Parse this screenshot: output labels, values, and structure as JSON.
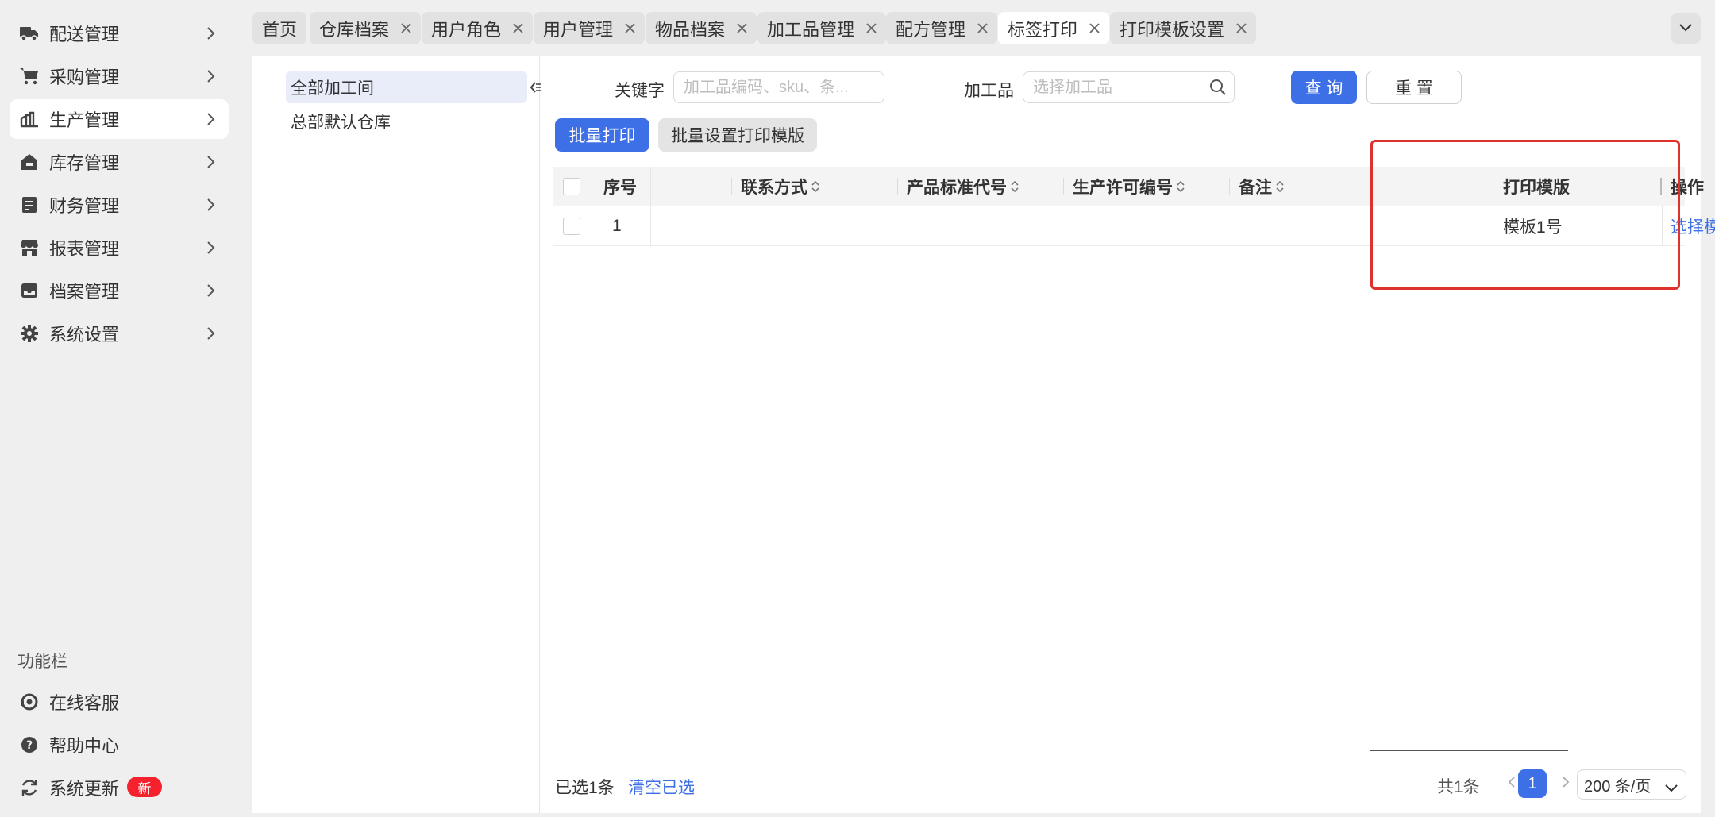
{
  "sidebar": {
    "items": [
      {
        "label": "配送管理",
        "icon": "truck-icon"
      },
      {
        "label": "采购管理",
        "icon": "cart-icon"
      },
      {
        "label": "生产管理",
        "icon": "production-icon"
      },
      {
        "label": "库存管理",
        "icon": "warehouse-icon"
      },
      {
        "label": "财务管理",
        "icon": "finance-icon"
      },
      {
        "label": "报表管理",
        "icon": "store-icon"
      },
      {
        "label": "档案管理",
        "icon": "inbox-icon"
      },
      {
        "label": "系统设置",
        "icon": "gear-icon"
      }
    ],
    "active_index": 2,
    "func_title": "功能栏",
    "func_items": [
      {
        "label": "在线客服",
        "icon": "support-icon"
      },
      {
        "label": "帮助中心",
        "icon": "help-icon"
      },
      {
        "label": "系统更新",
        "icon": "refresh-icon",
        "badge": "新"
      }
    ]
  },
  "tabs": [
    {
      "label": "首页",
      "closable": false
    },
    {
      "label": "仓库档案",
      "closable": true
    },
    {
      "label": "用户角色",
      "closable": true
    },
    {
      "label": "用户管理",
      "closable": true
    },
    {
      "label": "物品档案",
      "closable": true
    },
    {
      "label": "加工品管理",
      "closable": true
    },
    {
      "label": "配方管理",
      "closable": true
    },
    {
      "label": "标签打印",
      "closable": true,
      "active": true
    },
    {
      "label": "打印模板设置",
      "closable": true
    }
  ],
  "tree": {
    "items": [
      "全部加工间",
      "总部默认仓库"
    ],
    "active_index": 0
  },
  "filters": {
    "keyword_label": "关键字",
    "keyword_placeholder": "加工品编码、sku、条...",
    "product_label": "加工品",
    "product_placeholder": "选择加工品",
    "query_button": "查 询",
    "reset_button": "重 置"
  },
  "actions": {
    "batch_print": "批量打印",
    "batch_template": "批量设置打印模版"
  },
  "table": {
    "columns": {
      "index": "序号",
      "contact": "联系方式",
      "standard_code": "产品标准代号",
      "license_no": "生产许可编号",
      "remark": "备注",
      "template": "打印模版",
      "operation": "操作"
    },
    "rows": [
      {
        "index": "1",
        "template": "模板1号",
        "operation": "选择模板"
      }
    ]
  },
  "footer": {
    "selected_text": "已选1条",
    "clear_selected": "清空已选",
    "total_text": "共1条",
    "current_page": "1",
    "page_size": "200 条/页"
  },
  "colors": {
    "accent": "#3d6fe7",
    "highlight_box": "#e0322c",
    "badge": "#f5222d"
  }
}
